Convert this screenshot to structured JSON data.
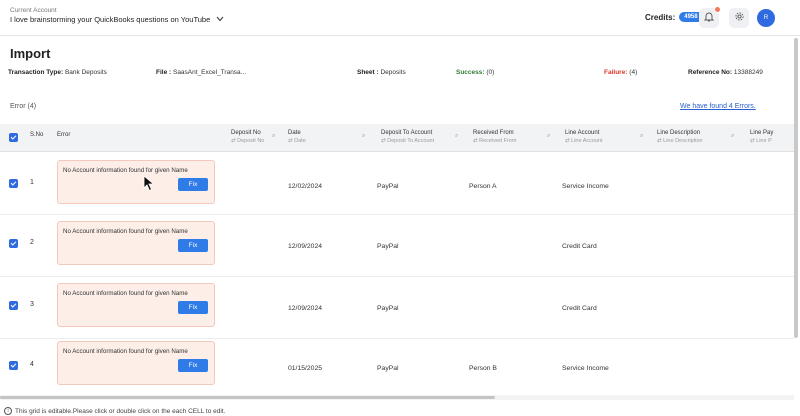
{
  "account": {
    "label": "Current Account",
    "name": "I love brainstorming your QuickBooks questions on YouTube"
  },
  "header": {
    "credits_label": "Credits:",
    "credits_value": "4958",
    "avatar_initial": "R"
  },
  "page": {
    "title": "Import",
    "transaction_type_label": "Transaction Type:",
    "transaction_type_value": "Bank Deposits",
    "file_label": "File :",
    "file_value": "SaasAnt_Excel_Transa...",
    "sheet_label": "Sheet :",
    "sheet_value": "Deposits",
    "success_label": "Success:",
    "success_value": "(0)",
    "failure_label": "Failure:",
    "failure_value": "(4)",
    "reference_label": "Reference No:",
    "reference_value": "13388249"
  },
  "errors": {
    "heading": "Error",
    "count": "(4)",
    "found_link": "We have found 4 Errors."
  },
  "grid": {
    "columns": [
      {
        "label": "S.No",
        "sub": ""
      },
      {
        "label": "Error",
        "sub": ""
      },
      {
        "label": "Deposit No",
        "sub": "⇄ Deposit No"
      },
      {
        "label": "Date",
        "sub": "⇄ Date"
      },
      {
        "label": "Deposit To Account",
        "sub": "⇄ Deposit To Account"
      },
      {
        "label": "Received From",
        "sub": "⇄ Received From"
      },
      {
        "label": "Line Account",
        "sub": "⇄ Line Account"
      },
      {
        "label": "Line Description",
        "sub": "⇄ Line Description"
      },
      {
        "label": "Line Pay",
        "sub": "⇄ Line P"
      }
    ],
    "rows": [
      {
        "sno": "1",
        "error": "No Account information found for given Name",
        "fix": "Fix",
        "deposit_no": "",
        "date": "12/02/2024",
        "deposit_to": "PayPal",
        "received_from": "Person A",
        "line_account": "Service Income",
        "line_desc": ""
      },
      {
        "sno": "2",
        "error": "No Account information found for given Name",
        "fix": "Fix",
        "deposit_no": "",
        "date": "12/09/2024",
        "deposit_to": "PayPal",
        "received_from": "",
        "line_account": "Credit Card",
        "line_desc": ""
      },
      {
        "sno": "3",
        "error": "No Account information found for given Name",
        "fix": "Fix",
        "deposit_no": "",
        "date": "12/09/2024",
        "deposit_to": "PayPal",
        "received_from": "",
        "line_account": "Credit Card",
        "line_desc": ""
      },
      {
        "sno": "4",
        "error": "No Account information found for given Name",
        "fix": "Fix",
        "deposit_no": "",
        "date": "01/15/2025",
        "deposit_to": "PayPal",
        "received_from": "Person B",
        "line_account": "Service Income",
        "line_desc": ""
      }
    ]
  },
  "footer": {
    "note": "This grid is editable.Please click or double click on the each CELL to edit."
  },
  "colors": {
    "accent": "#2f7be8",
    "error_bg": "#fdeee8",
    "success": "#2e7d32",
    "failure": "#d9342b"
  },
  "icons": [
    "chevron-down-icon",
    "bell-icon",
    "gear-icon",
    "search-icon",
    "checkbox-checked-icon",
    "info-icon",
    "mouse-cursor-icon"
  ]
}
